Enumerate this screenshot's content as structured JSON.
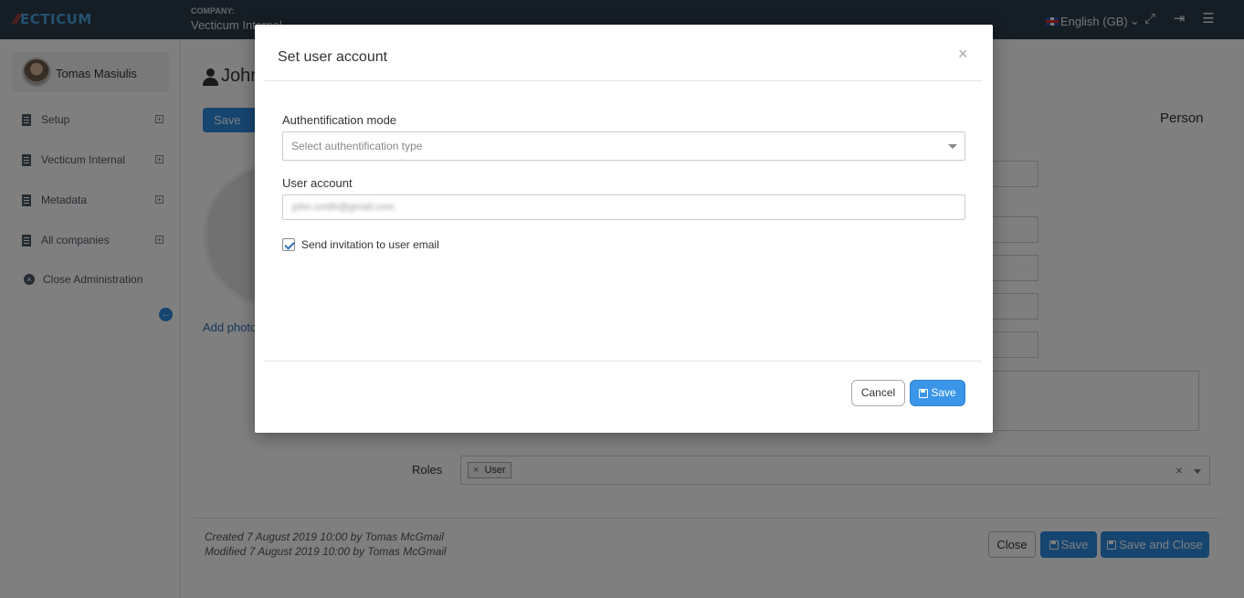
{
  "topbar": {
    "logo_text": "ECTICUM",
    "company_label": "COMPANY:",
    "company_name": "Vecticum Internal",
    "language": "English (GB)"
  },
  "sidebar": {
    "user_name": "Tomas Masiulis",
    "items": [
      {
        "label": "Setup"
      },
      {
        "label": "Vecticum Internal"
      },
      {
        "label": "Metadata"
      },
      {
        "label": "All companies"
      },
      {
        "label": "Close Administration"
      }
    ]
  },
  "main": {
    "title": "John",
    "save_label": "Save",
    "person_label": "Person",
    "add_photo": "Add photo",
    "roles_label": "Roles",
    "roles": [
      "User"
    ],
    "created_text": "Created 7 August 2019 10:00 by Tomas McGmail",
    "modified_text": "Modified 7 August 2019 10:00 by Tomas McGmail",
    "close_label": "Close",
    "save_and_close_label": "Save and Close"
  },
  "modal": {
    "title": "Set user account",
    "close_symbol": "×",
    "auth_mode_label": "Authentification mode",
    "auth_mode_placeholder": "Select authentification type",
    "user_account_label": "User account",
    "user_account_value": "john.smith@gmail.com",
    "send_invitation_label": "Send invitation to user email",
    "send_invitation_checked": true,
    "cancel_label": "Cancel",
    "save_label": "Save"
  },
  "colors": {
    "topbar": "#2b3a4a",
    "primary": "#2d8be0",
    "overlay": "rgba(0,0,0,0.5)"
  }
}
